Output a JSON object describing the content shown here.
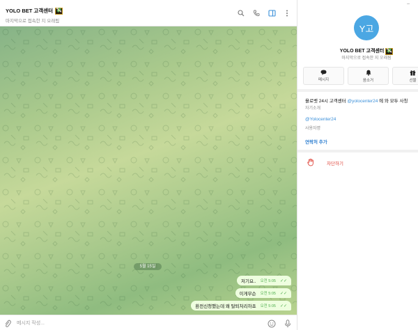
{
  "chat": {
    "title": "YOLO BET 고객센터",
    "title_emoji": "💸",
    "subtitle": "마지막으로 접속한 지 오래됨",
    "header_icons": [
      "search-icon",
      "phone-icon",
      "sidebar-icon",
      "more-icon"
    ],
    "date_label": "5월 15일",
    "messages": [
      {
        "text": "저기요..",
        "time": "오전 5:05",
        "status": "read"
      },
      {
        "text": "이게무슨",
        "time": "오전 5:05",
        "status": "read"
      },
      {
        "text": "환전신청했는데 왜 탈퇴처리하죠",
        "time": "오전 5:05",
        "status": "read"
      }
    ],
    "composer_placeholder": "메시지 작성..."
  },
  "profile": {
    "avatar_text": "Y고",
    "name": "YOLO BET 고객센터",
    "name_emoji": "💸",
    "status": "마지막으로 접속한 지 오래됨",
    "actions": [
      {
        "label": "메시지",
        "icon": "message-icon"
      },
      {
        "label": "음소거",
        "icon": "bell-icon"
      },
      {
        "label": "선물",
        "icon": "gift-icon"
      }
    ],
    "bio_prefix": "욜로벳 24시 고객센터 ",
    "bio_link": "@yolocenter24",
    "bio_suffix": " 에 와 모두 사칭",
    "bio_caption": "자기소개",
    "username": "@Yolocenter24",
    "username_caption": "사용자명",
    "add_contact": "연락처 추가",
    "block_label": "차단하기"
  },
  "colors": {
    "accent": "#3a8fd9",
    "avatar_bg": "#4ba7e3",
    "bubble_out": "#eefedf",
    "danger": "#e0483e",
    "chat_bg": "#a9c98c"
  }
}
